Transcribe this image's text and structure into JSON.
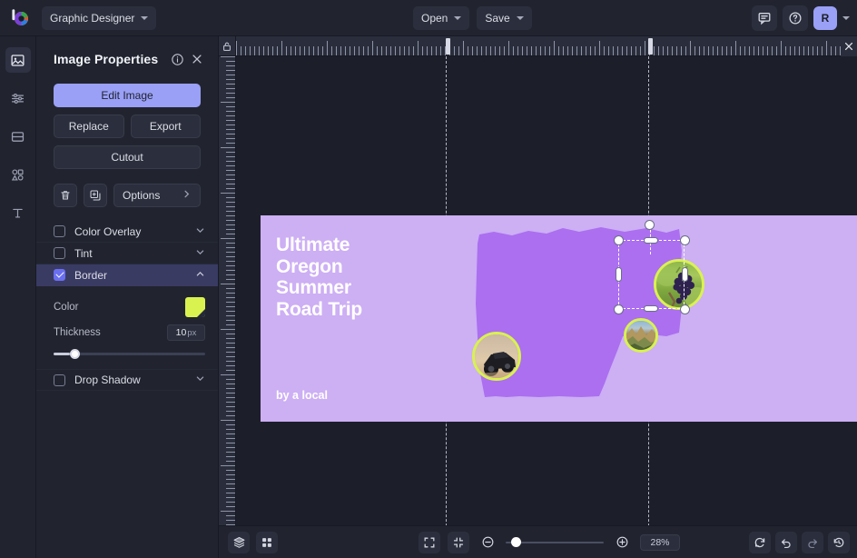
{
  "app": {
    "logo_icon": "brand-logo-icon",
    "doc_type": "Graphic Designer",
    "open_label": "Open",
    "save_label": "Save",
    "comments_icon": "comment-icon",
    "help_icon": "help-circle-icon",
    "avatar_initial": "R",
    "avatar_chevron_icon": "chevron-down-icon"
  },
  "rail": {
    "items": [
      {
        "icon": "image-icon",
        "name": "rail-item-image",
        "active": true
      },
      {
        "icon": "adjustments-icon",
        "name": "rail-item-adjustments",
        "active": false
      },
      {
        "icon": "layout-icon",
        "name": "rail-item-layout",
        "active": false
      },
      {
        "icon": "shapes-icon",
        "name": "rail-item-shapes",
        "active": false
      },
      {
        "icon": "text-icon",
        "name": "rail-item-text",
        "active": false
      }
    ]
  },
  "panel": {
    "title": "Image Properties",
    "info_icon": "info-circle-icon",
    "close_icon": "close-icon",
    "edit_image": "Edit Image",
    "replace": "Replace",
    "export": "Export",
    "cutout": "Cutout",
    "delete_icon": "trash-icon",
    "duplicate_icon": "duplicate-icon",
    "options": "Options",
    "options_caret_icon": "chevron-right-icon",
    "properties": [
      {
        "label": "Color Overlay",
        "checked": false,
        "expanded": false,
        "caret": "chevron-down-icon"
      },
      {
        "label": "Tint",
        "checked": false,
        "expanded": false,
        "caret": "chevron-down-icon"
      },
      {
        "label": "Border",
        "checked": true,
        "expanded": true,
        "caret": "chevron-up-icon"
      }
    ],
    "border": {
      "color_label": "Color",
      "color_value": "#d9f24f",
      "thickness_label": "Thickness",
      "thickness_value": "10",
      "thickness_unit": "px"
    },
    "drop_shadow": {
      "label": "Drop Shadow",
      "checked": false,
      "caret": "chevron-down-icon"
    }
  },
  "canvas": {
    "lock_icon": "lock-icon",
    "ruler_close_icon": "close-icon",
    "artboard": {
      "background": "#cdaff4",
      "map_color": "#ab6ff0",
      "title_lines": [
        "Ultimate",
        "Oregon",
        "Summer",
        "Road Trip"
      ],
      "byline": "by a local",
      "photos": [
        {
          "name": "photo-dune-buggy",
          "alt": "dune buggy on sand",
          "selected": false
        },
        {
          "name": "photo-canyon",
          "alt": "canyon landscape",
          "selected": false
        },
        {
          "name": "photo-grapes",
          "alt": "grapes on vine",
          "selected": true
        }
      ]
    }
  },
  "bottombar": {
    "layers_icon": "layers-icon",
    "grid_icon": "grid-icon",
    "fit_icon": "fit-to-screen-icon",
    "shrink_icon": "zoom-to-fit-icon",
    "zoom_out_icon": "zoom-out-icon",
    "zoom_in_icon": "zoom-in-icon",
    "zoom_value": "28%",
    "refresh_icon": "refresh-icon",
    "undo_icon": "undo-icon",
    "redo_icon": "redo-icon",
    "history_icon": "history-icon"
  }
}
